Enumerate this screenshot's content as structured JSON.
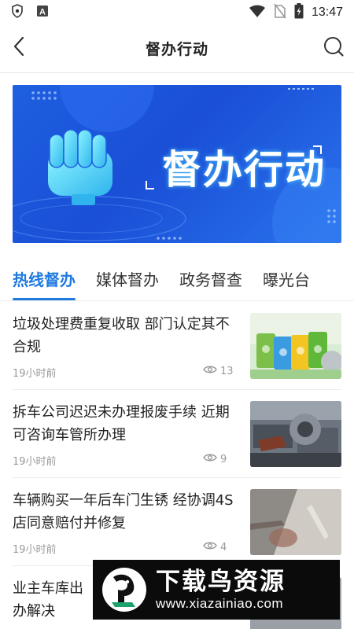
{
  "status_bar": {
    "time": "13:47",
    "left_icons": [
      "shield-icon",
      "a-icon"
    ],
    "right_icons": [
      "wifi-icon",
      "no-sim-icon",
      "battery-charging-icon"
    ]
  },
  "header": {
    "title": "督办行动",
    "back_icon": "back-arrow-icon",
    "search_icon": "search-icon"
  },
  "banner": {
    "text": "督办行动",
    "colors": {
      "primary": "#1e5fe0",
      "glow": "#5adcff"
    }
  },
  "tabs": [
    {
      "label": "热线督办",
      "active": true
    },
    {
      "label": "媒体督办",
      "active": false
    },
    {
      "label": "政务督查",
      "active": false
    },
    {
      "label": "曝光台",
      "active": false
    }
  ],
  "accent_color": "#1f7ae0",
  "news": [
    {
      "title": "垃圾处理费重复收取 部门认定其不合规",
      "time": "19小时前",
      "views": "13",
      "thumb": "trash-bins-image"
    },
    {
      "title": "拆车公司迟迟未办理报废手续 近期可咨询车管所办理",
      "time": "19小时前",
      "views": "9",
      "thumb": "scrap-cars-image"
    },
    {
      "title": "车辆购买一年后车门生锈 经协调4S店同意赔付并修复",
      "time": "19小时前",
      "views": "4",
      "thumb": "rusted-door-image"
    },
    {
      "title": "业主车库出 办解决",
      "time": "",
      "views": "",
      "thumb": ""
    }
  ],
  "watermark": {
    "title": "下载鸟资源",
    "url": "www.xiazainiao.com"
  }
}
